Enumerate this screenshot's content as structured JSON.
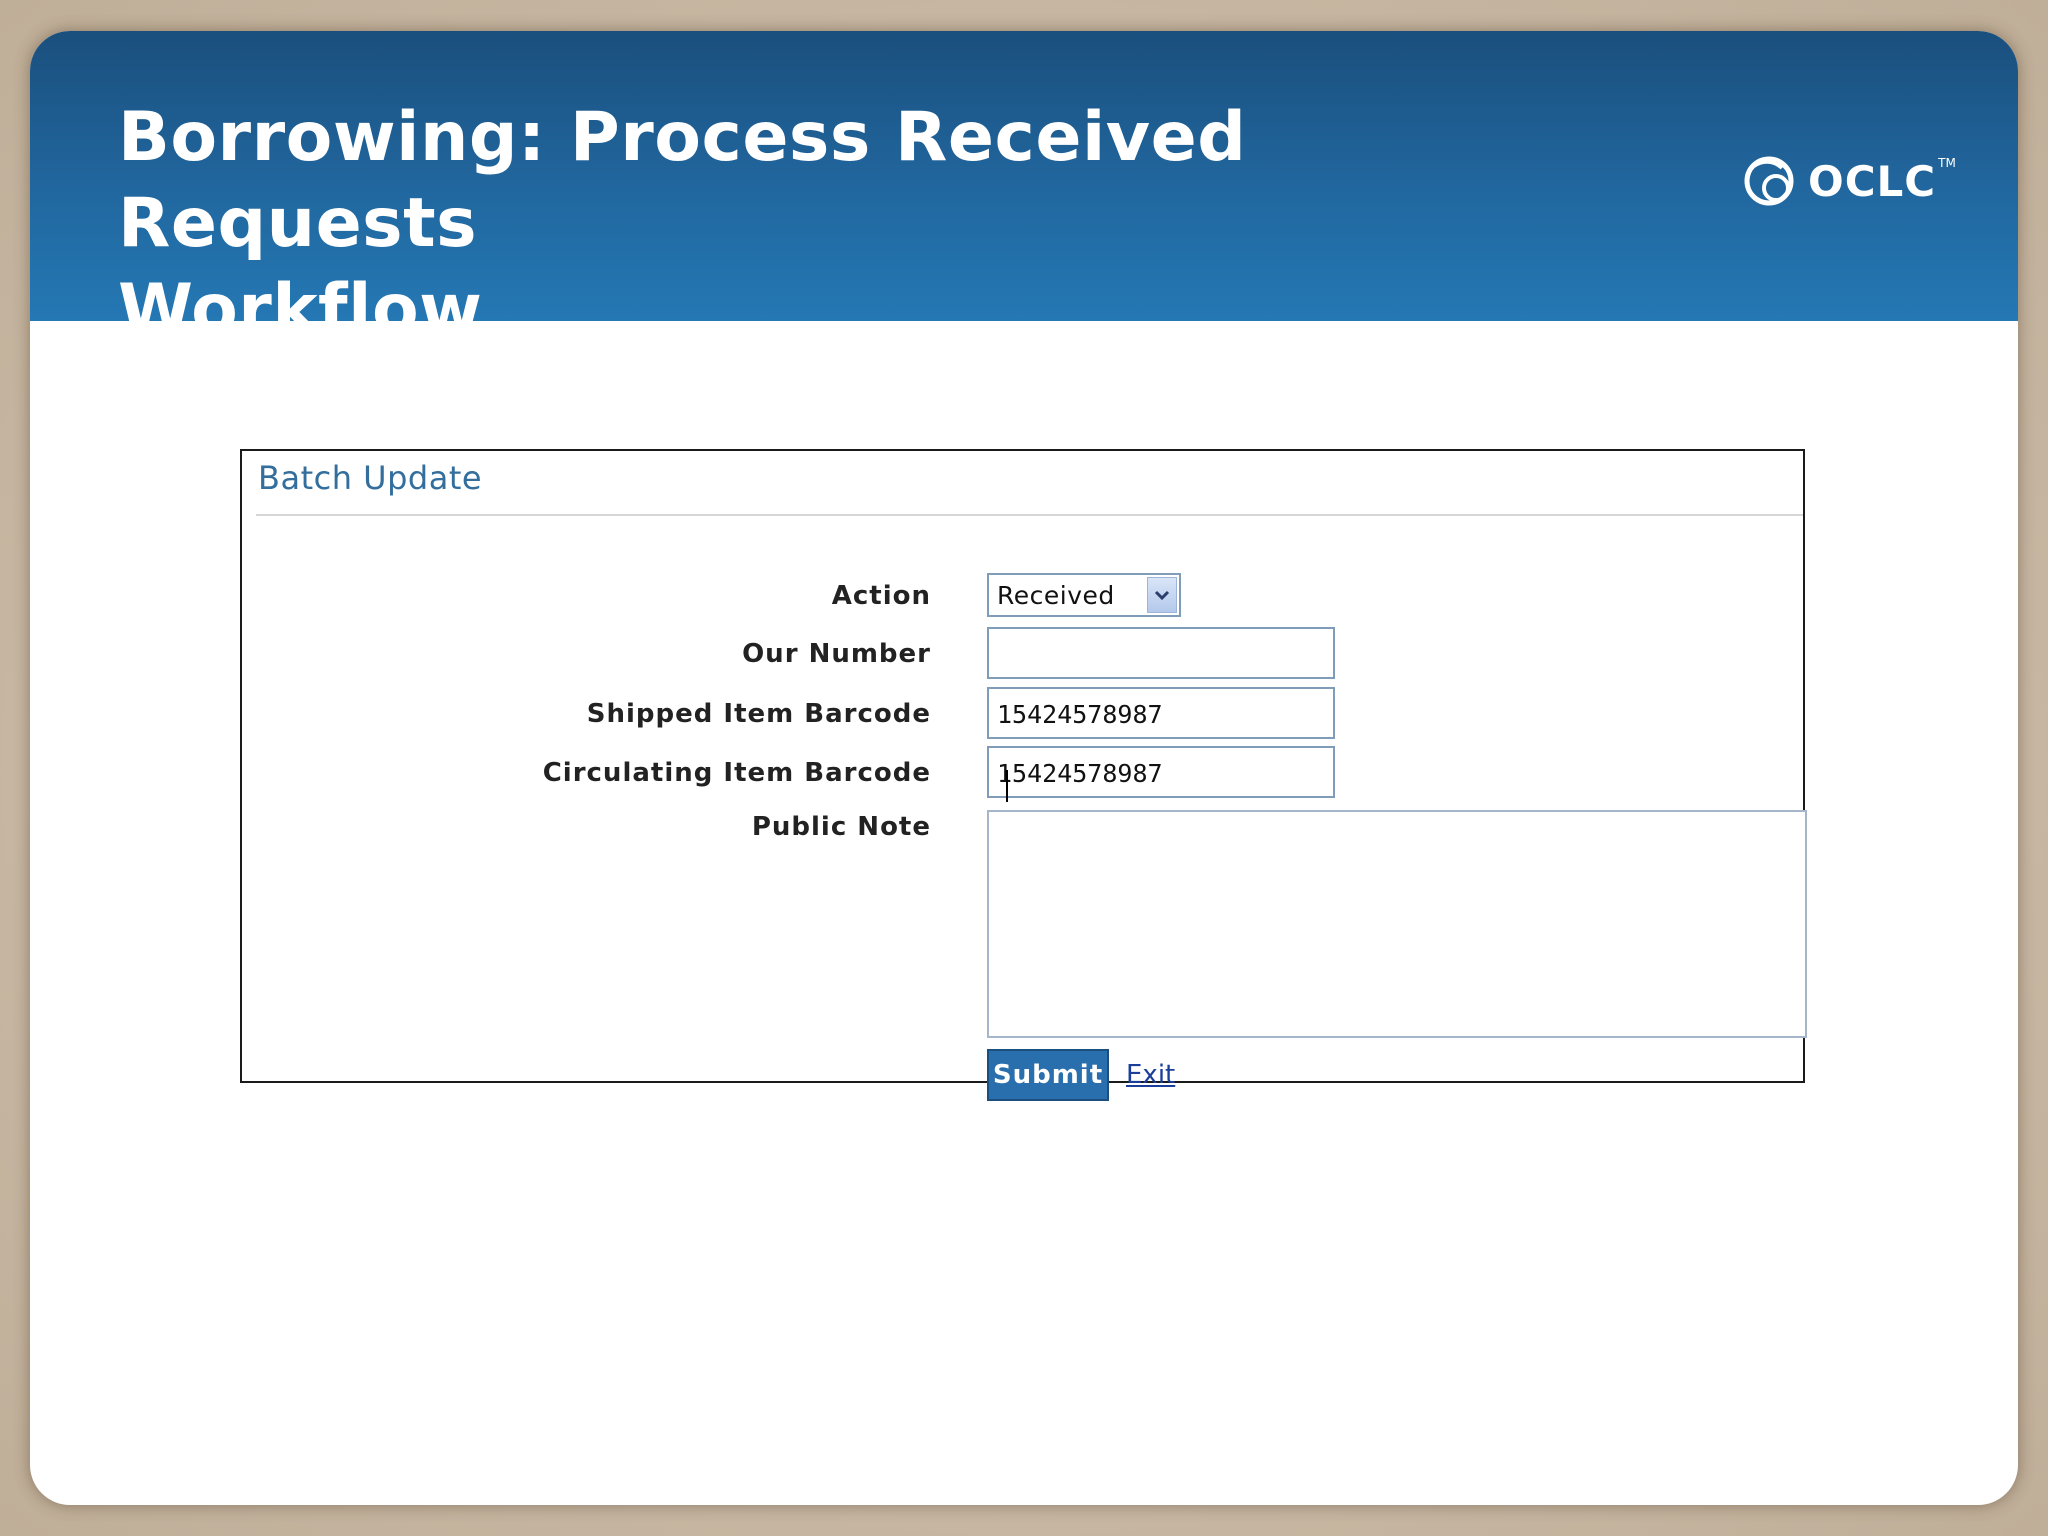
{
  "slide": {
    "title_line1": "Borrowing: Process Received Requests",
    "title_line2": "Workflow",
    "logo_text": "OCLC",
    "logo_tm": "TM",
    "banner_color": "#2171ab"
  },
  "panel": {
    "title": "Batch Update",
    "accent_color": "#336e9c",
    "fields": {
      "action": {
        "label": "Action",
        "value": "Received"
      },
      "our_number": {
        "label": "Our Number",
        "value": ""
      },
      "shipped_item_barcode": {
        "label": "Shipped Item Barcode",
        "value": "15424578987"
      },
      "circulating_item_barcode": {
        "label": "Circulating Item Barcode",
        "value": "15424578987"
      },
      "public_note": {
        "label": "Public Note",
        "value": ""
      }
    },
    "submit_label": "Submit",
    "exit_label": "Exit"
  },
  "icons": {
    "dropdown": "chevron-down-icon",
    "logo": "oclc-logo-icon"
  }
}
